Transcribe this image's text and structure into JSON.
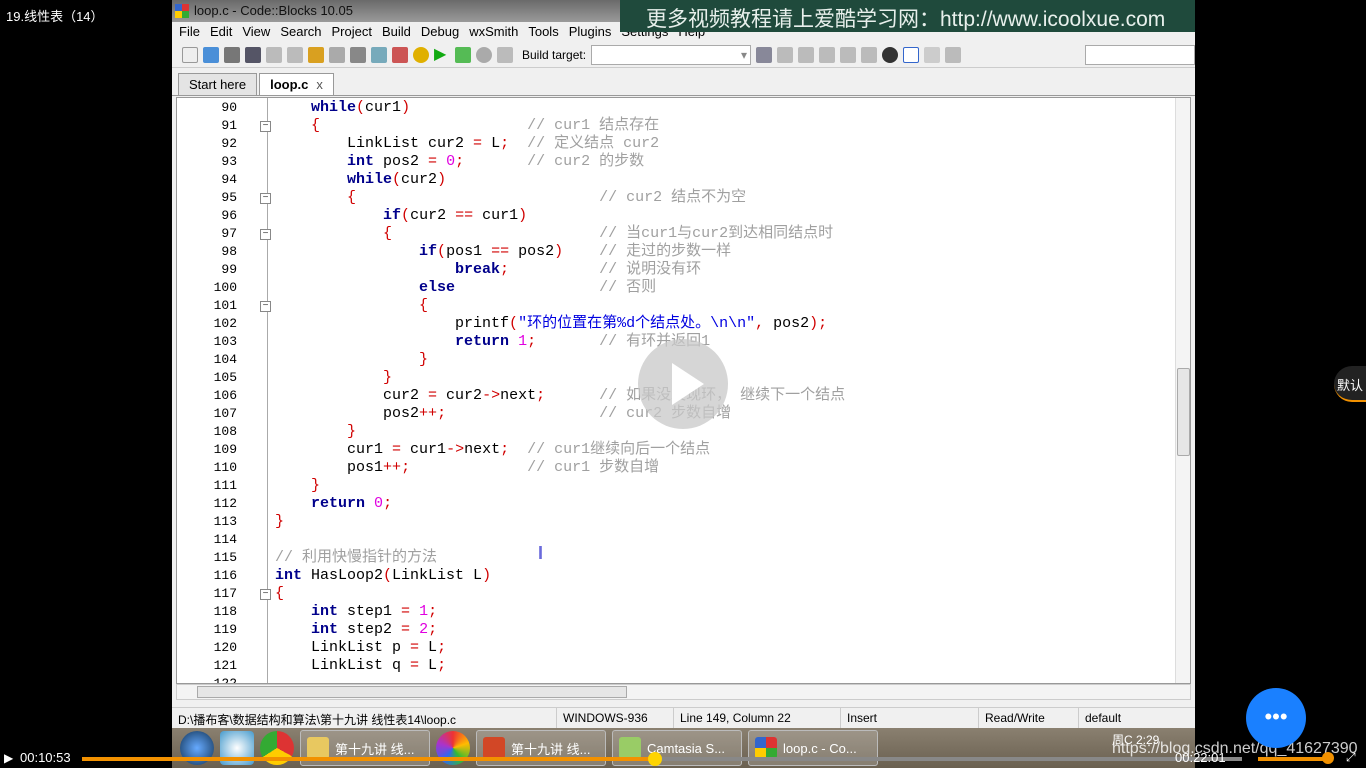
{
  "video": {
    "title": "19.线性表（14）",
    "current_time": "00:10:53",
    "total_time": "00:22:01",
    "progress_percent": 49.4,
    "volume_percent": 90,
    "quality_label": "默认",
    "accent": "#f29100"
  },
  "watermark_banner": "更多视频教程请上爱酷学习网：http://www.icoolxue.com",
  "window": {
    "title": "loop.c - Code::Blocks 10.05"
  },
  "menu": [
    "File",
    "Edit",
    "View",
    "Search",
    "Project",
    "Build",
    "Debug",
    "wxSmith",
    "Tools",
    "Plugins",
    "Settings",
    "Help"
  ],
  "toolbar": {
    "build_target_label": "Build target:",
    "build_target_value": ""
  },
  "tabs": [
    {
      "label": "Start here",
      "active": false
    },
    {
      "label": "loop.c",
      "active": true,
      "close": "x"
    }
  ],
  "editor": {
    "lines": [
      {
        "n": "90",
        "code": "    while(cur1)",
        "comment": ""
      },
      {
        "n": "91",
        "code": "    {                       ",
        "comment": "// cur1 结点存在",
        "fold": "open"
      },
      {
        "n": "92",
        "code": "        LinkList cur2 = L;  ",
        "comment": "// 定义结点 cur2"
      },
      {
        "n": "93",
        "code": "        int pos2 = 0;       ",
        "comment": "// cur2 的步数"
      },
      {
        "n": "94",
        "code": "        while(cur2)",
        "comment": ""
      },
      {
        "n": "95",
        "code": "        {                           ",
        "comment": "// cur2 结点不为空",
        "fold": "open"
      },
      {
        "n": "96",
        "code": "            if(cur2 == cur1)",
        "comment": ""
      },
      {
        "n": "97",
        "code": "            {                       ",
        "comment": "// 当cur1与cur2到达相同结点时",
        "fold": "open"
      },
      {
        "n": "98",
        "code": "                if(pos1 == pos2)    ",
        "comment": "// 走过的步数一样"
      },
      {
        "n": "99",
        "code": "                    break;          ",
        "comment": "// 说明没有环"
      },
      {
        "n": "100",
        "code": "                else                ",
        "comment": "// 否则"
      },
      {
        "n": "101",
        "code": "                {",
        "comment": "",
        "fold": "open"
      },
      {
        "n": "102",
        "code": "                    printf(\"环的位置在第%d个结点处。\\n\\n\", pos2);",
        "comment": ""
      },
      {
        "n": "103",
        "code": "                    return 1;       ",
        "comment": "// 有环并返回1"
      },
      {
        "n": "104",
        "code": "                }",
        "comment": "",
        "fold": "end"
      },
      {
        "n": "105",
        "code": "            }",
        "comment": "",
        "fold": "end"
      },
      {
        "n": "106",
        "code": "            cur2 = cur2->next;      ",
        "comment": "// 如果没发现环， 继续下一个结点"
      },
      {
        "n": "107",
        "code": "            pos2++;                 ",
        "comment": "// cur2 步数自增"
      },
      {
        "n": "108",
        "code": "        }",
        "comment": "",
        "fold": "end"
      },
      {
        "n": "109",
        "code": "        cur1 = cur1->next;  ",
        "comment": "// cur1继续向后一个结点"
      },
      {
        "n": "110",
        "code": "        pos1++;             ",
        "comment": "// cur1 步数自增"
      },
      {
        "n": "111",
        "code": "    }",
        "comment": "",
        "fold": "end"
      },
      {
        "n": "112",
        "code": "    return 0;",
        "comment": ""
      },
      {
        "n": "113",
        "code": "}",
        "comment": "",
        "fold": "end"
      },
      {
        "n": "114",
        "code": "",
        "comment": ""
      },
      {
        "n": "115",
        "code": "",
        "comment": "// 利用快慢指针的方法"
      },
      {
        "n": "116",
        "code": "int HasLoop2(LinkList L)",
        "comment": ""
      },
      {
        "n": "117",
        "code": "{",
        "comment": "",
        "fold": "open"
      },
      {
        "n": "118",
        "code": "    int step1 = 1;",
        "comment": ""
      },
      {
        "n": "119",
        "code": "    int step2 = 2;",
        "comment": ""
      },
      {
        "n": "120",
        "code": "    LinkList p = L;",
        "comment": ""
      },
      {
        "n": "121",
        "code": "    LinkList q = L;",
        "comment": ""
      },
      {
        "n": "122",
        "code": "",
        "comment": ""
      }
    ]
  },
  "status": {
    "path": "D:\\播布客\\数据结构和算法\\第十九讲 线性表14\\loop.c",
    "encoding": "WINDOWS-936",
    "position": "Line 149, Column 22",
    "mode": "Insert",
    "access": "Read/Write",
    "profile": "default"
  },
  "taskbar": {
    "buttons": [
      "第十九讲 线...",
      "第十九讲 线...",
      "Camtasia S...",
      "loop.c - Co..."
    ],
    "clock": "周C 2:29"
  },
  "url_watermark": "https://blog.csdn.net/qq_41627390"
}
